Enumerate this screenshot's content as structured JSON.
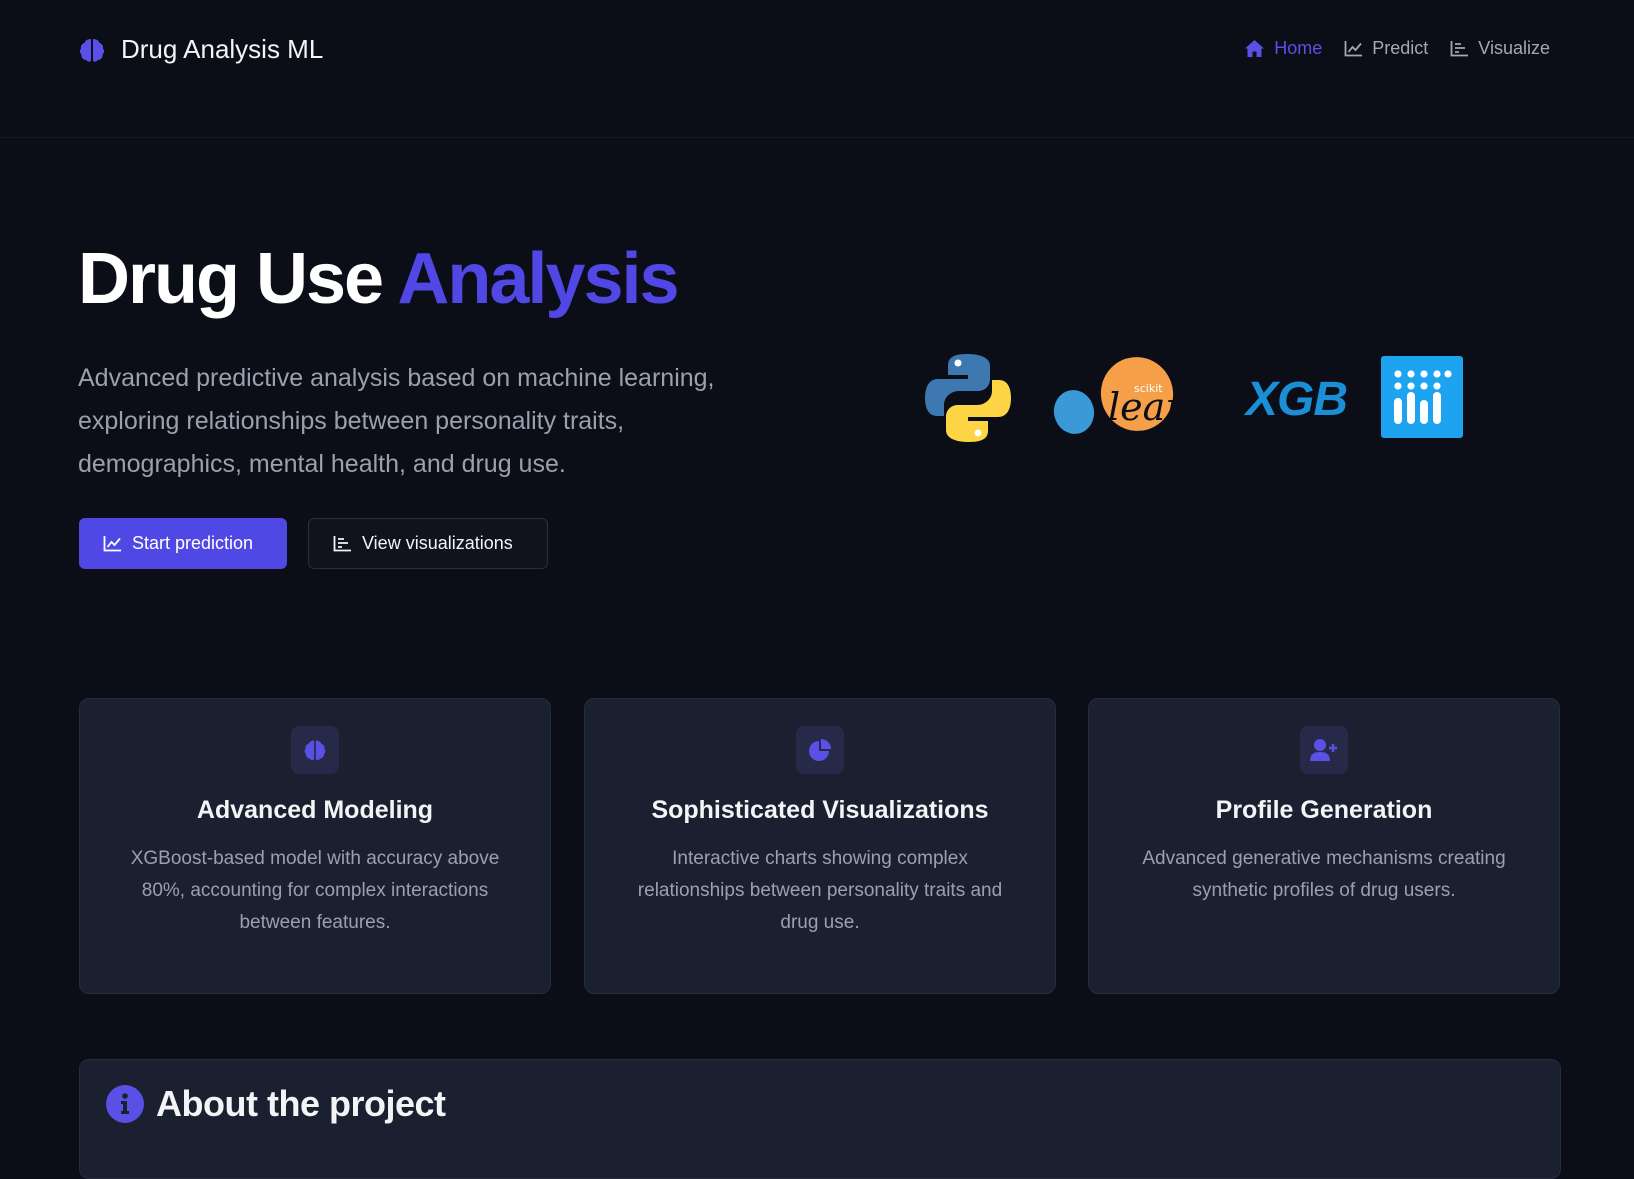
{
  "app": {
    "name": "Drug Analysis ML",
    "brand_icon": "brain-icon"
  },
  "nav": {
    "items": [
      {
        "label": "Home",
        "icon": "home-icon",
        "active": true
      },
      {
        "label": "Predict",
        "icon": "line-chart-icon",
        "active": false
      },
      {
        "label": "Visualize",
        "icon": "bar-chart-icon",
        "active": false
      }
    ]
  },
  "hero": {
    "title_main": "Drug Use ",
    "title_accent": "Analysis",
    "description": "Advanced predictive analysis based on machine learning, exploring relationships between personality traits, demographics, mental health, and drug use.",
    "primary_button": "Start prediction",
    "secondary_button": "View visualizations"
  },
  "logos": {
    "scikit_small": "scikit",
    "scikit_main": "learn",
    "xgb": "XGB"
  },
  "cards": [
    {
      "title": "Advanced Modeling",
      "text": "XGBoost-based model with accuracy above 80%, accounting for complex interactions between features.",
      "icon": "brain-icon"
    },
    {
      "title": "Sophisticated Visualizations",
      "text": "Interactive charts showing complex relationships between personality traits and drug use.",
      "icon": "pie-chart-icon"
    },
    {
      "title": "Profile Generation",
      "text": "Advanced generative mechanisms creating synthetic profiles of drug users.",
      "icon": "user-plus-icon"
    }
  ],
  "about": {
    "title": "About the project",
    "icon": "info-icon"
  },
  "colors": {
    "background": "#0b0e17",
    "accent": "#5147e5",
    "card": "#1b2030",
    "muted_text": "#9aa0ae"
  }
}
